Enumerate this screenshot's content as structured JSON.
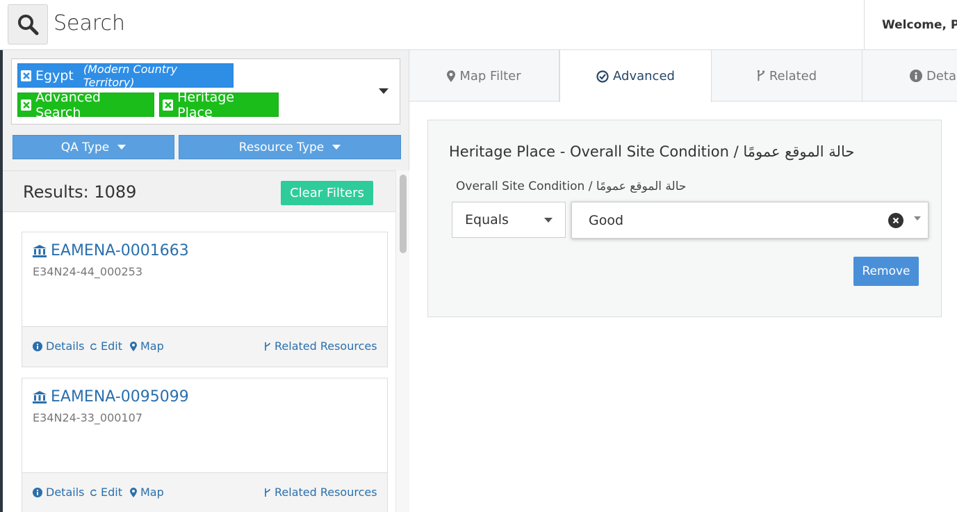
{
  "header": {
    "title": "Search",
    "welcome": "Welcome, Pa"
  },
  "filters": {
    "tags": [
      {
        "label": "Egypt",
        "sub": "(Modern Country Territory)",
        "color": "#2e8ee6"
      },
      {
        "label": "Advanced Search",
        "color": "#1bbd1b"
      },
      {
        "label": "Heritage Place",
        "color": "#1bbd1b"
      }
    ],
    "qa_type": "QA Type",
    "resource_type": "Resource Type"
  },
  "results": {
    "label": "Results: 1089",
    "clear_filters": "Clear Filters",
    "items": [
      {
        "title": "EAMENA-0001663",
        "sub": "E34N24-44_000253"
      },
      {
        "title": "EAMENA-0095099",
        "sub": "E34N24-33_000107"
      }
    ],
    "actions": {
      "details": "Details",
      "edit": "Edit",
      "map": "Map",
      "related": "Related Resources"
    }
  },
  "tabs": [
    {
      "label": "Map Filter",
      "icon": "map-marker-icon"
    },
    {
      "label": "Advanced",
      "icon": "check-circle-icon",
      "active": true
    },
    {
      "label": "Related",
      "icon": "branch-icon"
    },
    {
      "label": "Detai",
      "icon": "info-icon"
    }
  ],
  "advanced": {
    "panel_title": "Heritage Place - Overall Site Condition / حالة الموقع عمومًا",
    "field_label": "Overall Site Condition / حالة الموقع عمومًا",
    "operator": "Equals",
    "value": "Good",
    "remove": "Remove"
  },
  "colors": {
    "accent": "#2a6fad",
    "green_tag": "#1bbd1b",
    "blue_tag": "#2e8ee6",
    "clear_btn": "#2ecc9a"
  }
}
